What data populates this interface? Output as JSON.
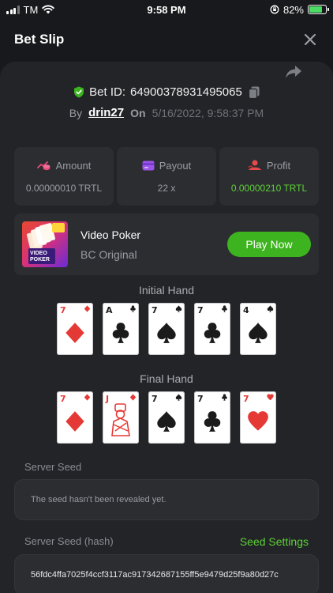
{
  "status_bar": {
    "carrier": "TM",
    "time": "9:58 PM",
    "battery": "82%",
    "battery_level": 0.82
  },
  "header": {
    "title": "Bet Slip"
  },
  "bet": {
    "id_label": "Bet ID:",
    "id_value": "64900378931495065",
    "by_label": "By",
    "user": "drin27",
    "on_label": "On",
    "date": "5/16/2022, 9:58:37 PM"
  },
  "stats": [
    {
      "label": "Amount",
      "value": "0.00000010 TRTL",
      "icon": "coins-icon",
      "color": "#e74a79"
    },
    {
      "label": "Payout",
      "value": "22 x",
      "icon": "wallet-icon",
      "color": "#9b55e8"
    },
    {
      "label": "Profit",
      "value": "0.00000210 TRTL",
      "icon": "profit-icon",
      "color": "#e74a4a",
      "value_color": "#5dd136"
    }
  ],
  "game": {
    "name": "Video Poker",
    "subtitle": "BC Original",
    "thumb_label": "VIDEO POKER",
    "play_label": "Play Now"
  },
  "initial_hand": {
    "title": "Initial Hand",
    "cards": [
      {
        "rank": "7",
        "suit": "diamond"
      },
      {
        "rank": "A",
        "suit": "club"
      },
      {
        "rank": "7",
        "suit": "spade"
      },
      {
        "rank": "7",
        "suit": "club"
      },
      {
        "rank": "4",
        "suit": "spade"
      }
    ]
  },
  "final_hand": {
    "title": "Final Hand",
    "cards": [
      {
        "rank": "7",
        "suit": "diamond"
      },
      {
        "rank": "J",
        "suit": "diamond",
        "face": true
      },
      {
        "rank": "7",
        "suit": "spade"
      },
      {
        "rank": "7",
        "suit": "club"
      },
      {
        "rank": "7",
        "suit": "heart"
      }
    ]
  },
  "server_seed": {
    "label": "Server Seed",
    "value": "The seed hasn't been revealed yet."
  },
  "server_seed_hash": {
    "label": "Server Seed (hash)",
    "settings_label": "Seed Settings",
    "value": "56fdc4ffa7025f4ccf3117ac917342687155ff5e9479d25f9a80d27c"
  },
  "colors": {
    "accent_green": "#3db41f",
    "profit_green": "#5dd136",
    "red_suit": "#e53935",
    "black_suit": "#1b1b1b"
  }
}
